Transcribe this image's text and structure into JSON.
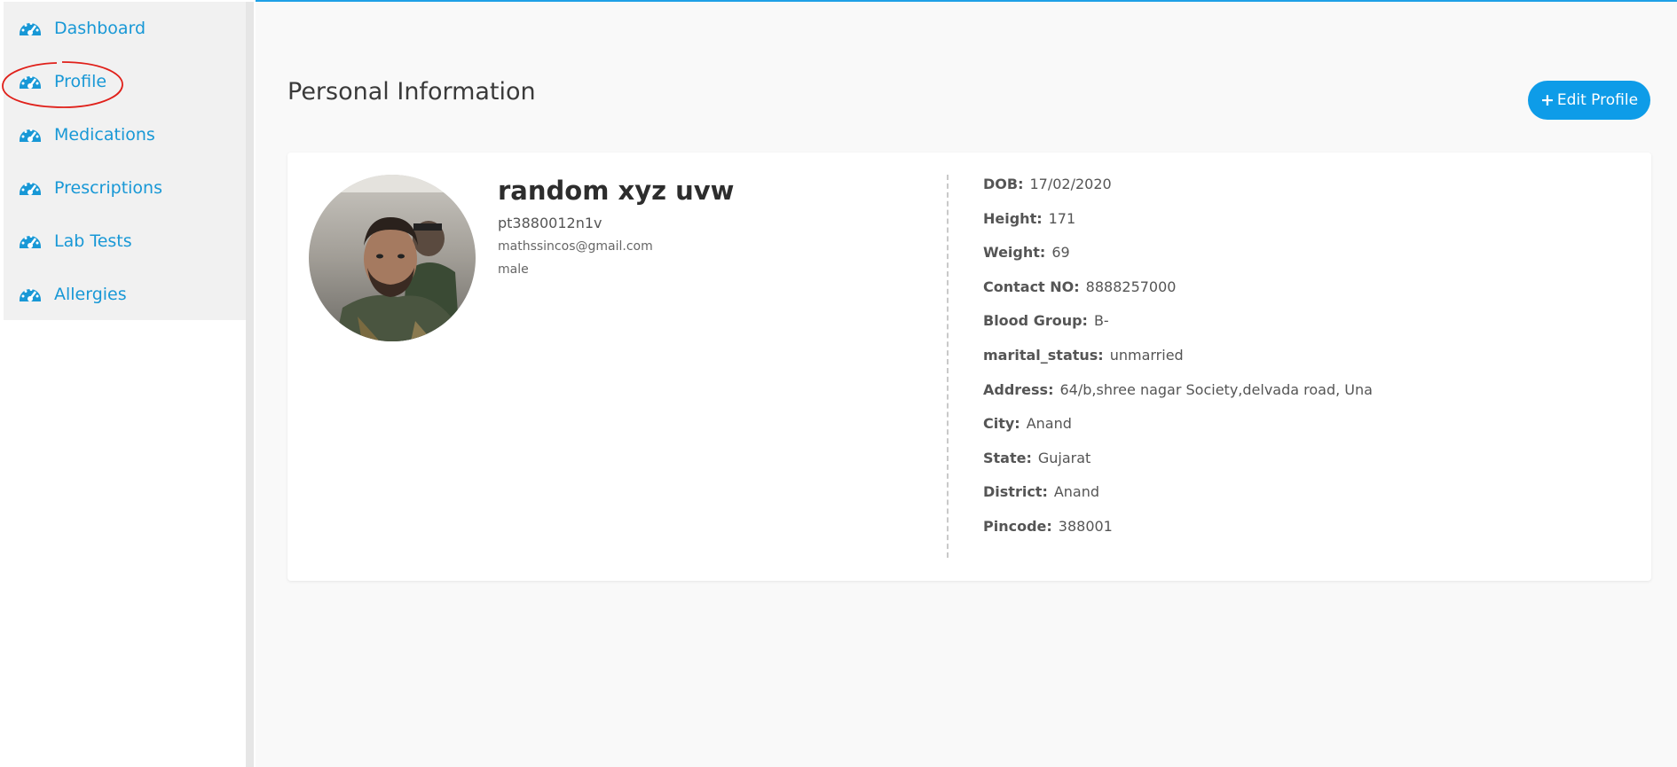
{
  "sidebar": {
    "items": [
      {
        "label": "Dashboard",
        "icon": "speedometer-icon"
      },
      {
        "label": "Profile",
        "icon": "speedometer-icon",
        "annotated": true
      },
      {
        "label": "Medications",
        "icon": "speedometer-icon"
      },
      {
        "label": "Prescriptions",
        "icon": "speedometer-icon"
      },
      {
        "label": "Lab Tests",
        "icon": "speedometer-icon"
      },
      {
        "label": "Allergies",
        "icon": "speedometer-icon"
      }
    ]
  },
  "main": {
    "title": "Personal Information",
    "edit_button": {
      "icon": "plus-icon",
      "label": "Edit Profile"
    },
    "profile": {
      "name": "random xyz uvw",
      "patient_id": "pt3880012n1v",
      "email": "mathssincos@gmail.com",
      "gender": "male"
    },
    "details": [
      {
        "key": "DOB:",
        "value": "17/02/2020"
      },
      {
        "key": "Height:",
        "value": "171"
      },
      {
        "key": "Weight:",
        "value": "69"
      },
      {
        "key": "Contact NO:",
        "value": "8888257000"
      },
      {
        "key": "Blood Group:",
        "value": "B-"
      },
      {
        "key": "marital_status:",
        "value": "unmarried"
      },
      {
        "key": "Address:",
        "value": "64/b,shree nagar Society,delvada road, Una"
      },
      {
        "key": "City:",
        "value": "Anand"
      },
      {
        "key": "State:",
        "value": "Gujarat"
      },
      {
        "key": "District:",
        "value": "Anand"
      },
      {
        "key": "Pincode:",
        "value": "388001"
      }
    ]
  },
  "colors": {
    "accent": "#0e9ce8",
    "nav_text": "#1898d6",
    "annotation": "#e0201a"
  }
}
